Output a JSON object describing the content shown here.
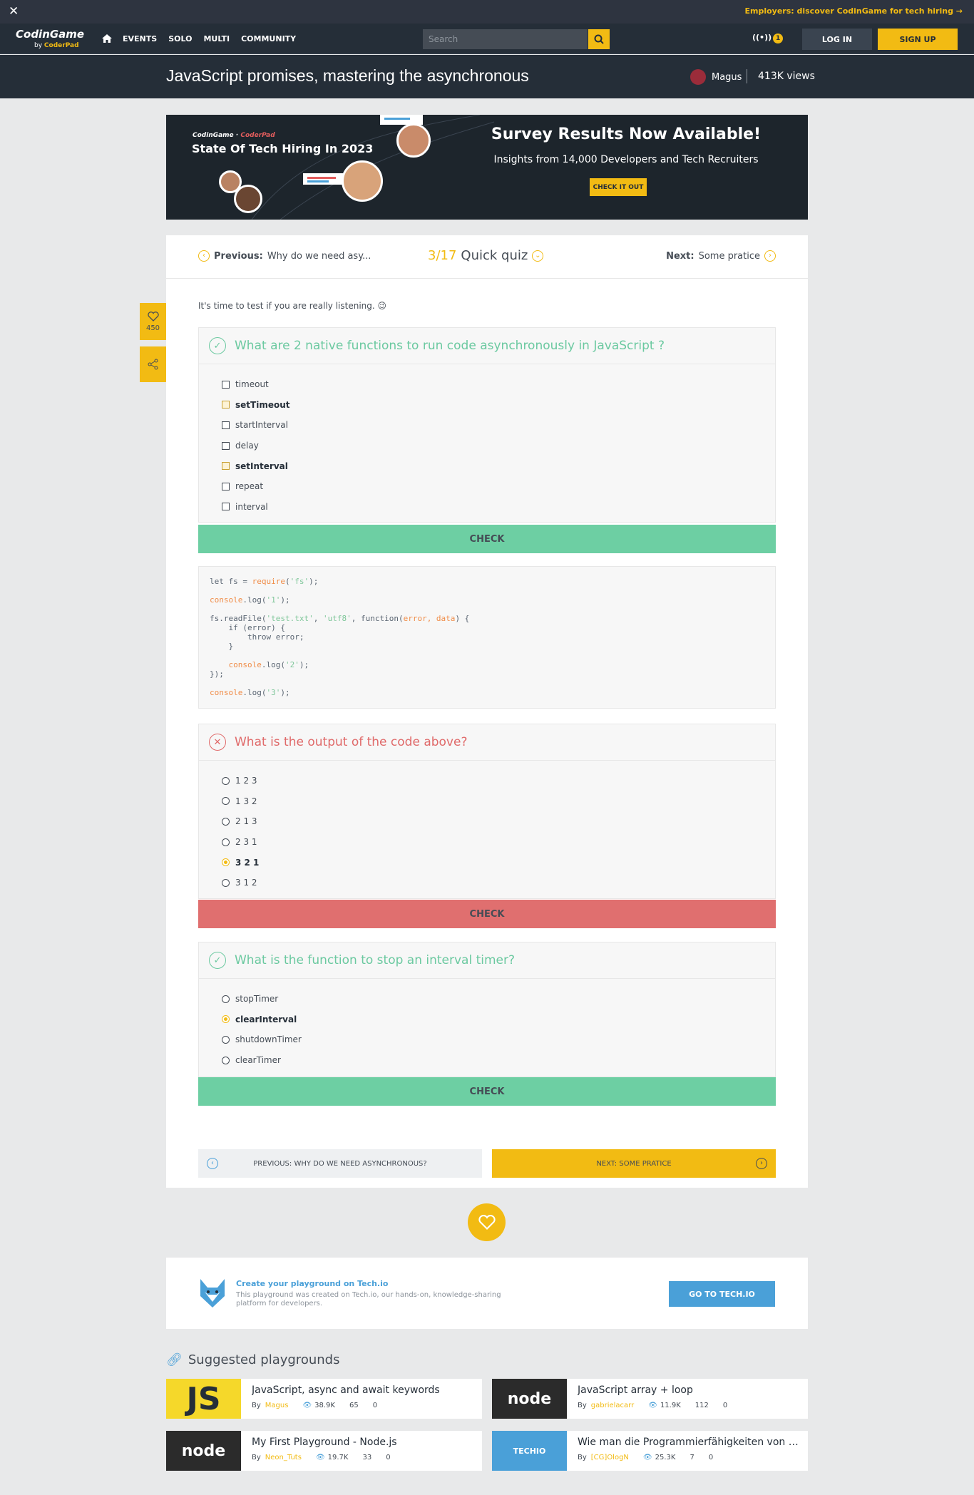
{
  "topbar": {
    "close_glyph": "✕",
    "promo": "Employers: discover CodinGame for tech hiring →"
  },
  "nav": {
    "logo_main": "CodinGame",
    "logo_by": "by",
    "logo_sub": "CoderPad",
    "links": [
      "EVENTS",
      "SOLO",
      "MULTI",
      "COMMUNITY"
    ],
    "search_placeholder": "Search",
    "notif_count": "1",
    "login": "LOG IN",
    "signup": "SIGN UP"
  },
  "title": {
    "text": "JavaScript promises, mastering the asynchronous",
    "author": "Magus",
    "views": "413K views"
  },
  "ad": {
    "brand_a": "CodinGame",
    "brand_b": "CoderPad",
    "tagline": "State Of Tech Hiring In 2023",
    "headline": "Survey Results Now Available!",
    "insights": "Insights from 14,000 Developers and Tech Recruiters",
    "cta": "CHECK IT OUT"
  },
  "pager": {
    "prev_label": "Previous:",
    "prev_title": "Why do we need asy...",
    "progress": "3/17",
    "section": "Quick quiz",
    "next_label": "Next:",
    "next_title": "Some pratice"
  },
  "intro": "It's time to test if you are really listening. 😉",
  "quiz1": {
    "question": "What are 2 native functions to run code asynchronously in JavaScript ?",
    "options": [
      "timeout",
      "setTimeout",
      "startInterval",
      "delay",
      "setInterval",
      "repeat",
      "interval"
    ],
    "check": "CHECK"
  },
  "quiz2": {
    "question": "What is the output of the code above?",
    "options": [
      "1 2 3",
      "1 3 2",
      "2 1 3",
      "2 3 1",
      "3 2 1",
      "3 1 2"
    ],
    "check": "CHECK"
  },
  "quiz3": {
    "question": "What is the function to stop an interval timer?",
    "options": [
      "stopTimer",
      "clearInterval",
      "shutdownTimer",
      "clearTimer"
    ],
    "check": "CHECK"
  },
  "bottomnav": {
    "prev": "PREVIOUS: WHY DO WE NEED ASYNCHRONOUS?",
    "next": "NEXT: SOME PRATICE"
  },
  "likes": "450",
  "techio": {
    "title": "Create your playground on Tech.io",
    "desc": "This playground was created on Tech.io, our hands-on, knowledge-sharing platform for developers.",
    "button": "GO TO TECH.IO"
  },
  "suggested": {
    "title": "Suggested playgrounds",
    "by": "By",
    "cards": [
      {
        "thumb": "JS",
        "title": "JavaScript, async and await keywords",
        "author": "Magus",
        "views": "38.9K",
        "likes": "65",
        "comments": "0"
      },
      {
        "thumb": "node",
        "title": "JavaScript array + loop",
        "author": "gabrielacarr",
        "views": "11.9K",
        "likes": "112",
        "comments": "0"
      },
      {
        "thumb": "node",
        "title": "My First Playground - Node.js",
        "author": "Neon_Tuts",
        "views": "19.7K",
        "likes": "33",
        "comments": "0"
      },
      {
        "thumb": "TECHIO",
        "title": "Wie man die Programmierfähigkeiten von En...",
        "author": "[CG]OlogN",
        "views": "25.3K",
        "likes": "7",
        "comments": "0"
      }
    ]
  }
}
